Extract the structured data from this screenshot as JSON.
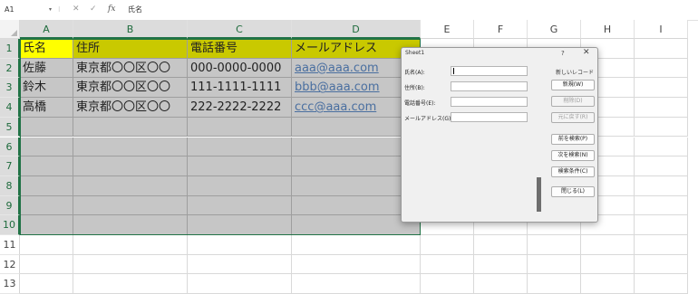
{
  "formula_bar": {
    "name_box": "A1",
    "name_caret": "▾",
    "sep": "⁝",
    "cancel_icon": "✕",
    "enter_icon": "✓",
    "fx_label": "fx",
    "value": "氏名"
  },
  "columns": [
    "A",
    "B",
    "C",
    "D",
    "E",
    "F",
    "G",
    "H",
    "I"
  ],
  "row_numbers": [
    "1",
    "2",
    "3",
    "4",
    "5",
    "6",
    "7",
    "8",
    "9",
    "10",
    "11",
    "12",
    "13"
  ],
  "table": {
    "headers": [
      "氏名",
      "住所",
      "電話番号",
      "メールアドレス"
    ],
    "rows": [
      [
        "佐藤",
        "東京都〇〇区〇〇",
        "000-0000-0000",
        "aaa@aaa.com"
      ],
      [
        "鈴木",
        "東京都〇〇区〇〇",
        "111-1111-1111",
        "bbb@aaa.com"
      ],
      [
        "高橋",
        "東京都〇〇区〇〇",
        "222-2222-2222",
        "ccc@aaa.com"
      ]
    ]
  },
  "dialog": {
    "title": "Sheet1",
    "help": "?",
    "close": "✕",
    "record_label": "新しいレコード",
    "fields": [
      {
        "label": "氏名(A):",
        "value": ""
      },
      {
        "label": "住所(B):",
        "value": ""
      },
      {
        "label": "電話番号(E):",
        "value": ""
      },
      {
        "label": "メールアドレス(G):",
        "value": ""
      }
    ],
    "buttons": {
      "new": "新規(W)",
      "delete": "削除(D)",
      "restore": "元に戻す(R)",
      "find_prev": "前を検索(P)",
      "find_next": "次を検索(N)",
      "criteria": "検索条件(C)",
      "close": "閉じる(L)"
    }
  },
  "colors": {
    "header_yellow": "#ffff00",
    "header_olive": "#c9c900",
    "selection": "#c6c6c6",
    "excel_green": "#217346",
    "link": "#4a6fa0"
  }
}
